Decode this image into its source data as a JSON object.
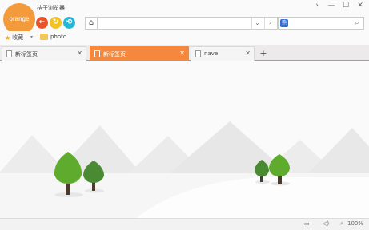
{
  "app": {
    "title": "桔子浏览器",
    "logo_text": "orange"
  },
  "window_controls": {
    "menu": "›",
    "minimize": "—",
    "maximize": "☐",
    "close": "✕"
  },
  "nav": {
    "back": "←",
    "forward": "↻",
    "refresh": "⟲"
  },
  "address": {
    "home": "⌂",
    "value": "",
    "dropdown": "⌄",
    "go": "›"
  },
  "search": {
    "engine": "熊",
    "value": "",
    "button": "⌕"
  },
  "bookmarks": {
    "favorites": "收藏",
    "caret": "▾",
    "folder": "photo"
  },
  "tabs": [
    {
      "label": "新标签页",
      "close": "✕",
      "active": false
    },
    {
      "label": "新标签页",
      "close": "✕",
      "active": true
    },
    {
      "label": "nave",
      "close": "✕",
      "active": false
    }
  ],
  "new_tab": "+",
  "status": {
    "window_icon": "▭",
    "sound_icon": "◁)",
    "zoom_icon": "⌕",
    "zoom": "100%"
  },
  "colors": {
    "accent": "#f5883c",
    "back": "#e9532a",
    "forward": "#f3c21d",
    "refresh": "#27b7d6",
    "tree_light": "#5eab2e",
    "tree_dark": "#4a8a33"
  }
}
